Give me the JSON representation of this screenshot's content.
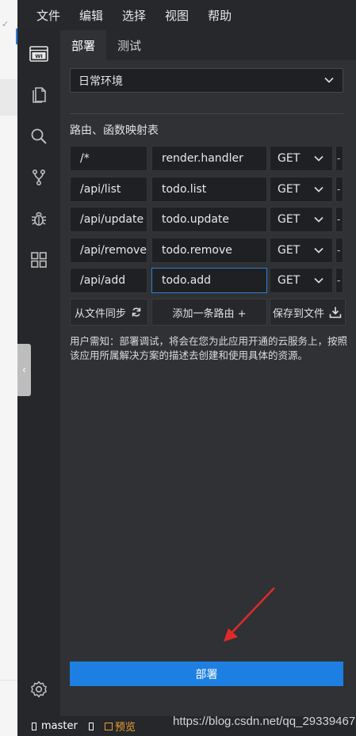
{
  "menubar": {
    "items": [
      "文件",
      "编辑",
      "选择",
      "视图",
      "帮助"
    ]
  },
  "activity_bar": {
    "icons": [
      "webide-logo-icon",
      "files-icon",
      "search-icon",
      "source-control-icon",
      "debug-icon",
      "extensions-icon",
      "settings-icon"
    ],
    "logo_text": "WI"
  },
  "panel": {
    "tabs": [
      {
        "label": "部署",
        "active": true
      },
      {
        "label": "测试",
        "active": false
      }
    ],
    "environment": {
      "value": "日常环境"
    },
    "routes_title": "路由、函数映射表",
    "routes": [
      {
        "path": "/*",
        "handler": "render.handler",
        "method": "GET"
      },
      {
        "path": "/api/list",
        "handler": "todo.list",
        "method": "GET"
      },
      {
        "path": "/api/update",
        "handler": "todo.update",
        "method": "GET"
      },
      {
        "path": "/api/remove",
        "handler": "todo.remove",
        "method": "GET"
      },
      {
        "path": "/api/add",
        "handler": "todo.add",
        "method": "GET"
      }
    ],
    "row_extra": "-",
    "actions": {
      "sync_label": "从文件同步",
      "add_label": "添加一条路由 +",
      "save_label": "保存到文件"
    },
    "notice": "用户需知：部署调试，将会在您为此应用开通的云服务上，按照该应用所属解决方案的描述去创建和使用具体的资源。",
    "deploy_label": "部署"
  },
  "status_bar": {
    "branch": "master",
    "preview": "预览"
  },
  "watermark": "https://blog.csdn.net/qq_29339467",
  "colors": {
    "accent": "#1d7fe2",
    "annotation_arrow": "#e02a2a",
    "preview": "#f0a030"
  }
}
